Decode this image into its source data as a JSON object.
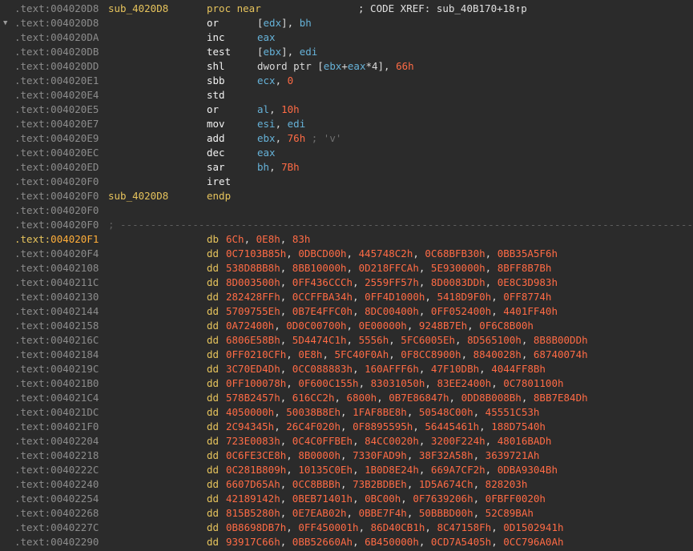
{
  "segment": ".text",
  "code": [
    {
      "addr": "004020D8",
      "label": "sub_4020D8",
      "mnem": "proc near",
      "mnem_kw": true,
      "xref": "; CODE XREF: sub_40B170+18↑p",
      "ops": []
    },
    {
      "addr": "004020D8",
      "arrow": "▼",
      "mnem": "or",
      "ops": [
        {
          "t": "txt",
          "v": "["
        },
        {
          "t": "reg",
          "v": "edx"
        },
        {
          "t": "txt",
          "v": "], "
        },
        {
          "t": "reg",
          "v": "bh"
        }
      ]
    },
    {
      "addr": "004020DA",
      "mnem": "inc",
      "ops": [
        {
          "t": "reg",
          "v": "eax"
        }
      ]
    },
    {
      "addr": "004020DB",
      "mnem": "test",
      "ops": [
        {
          "t": "txt",
          "v": "["
        },
        {
          "t": "reg",
          "v": "ebx"
        },
        {
          "t": "txt",
          "v": "], "
        },
        {
          "t": "reg",
          "v": "edi"
        }
      ]
    },
    {
      "addr": "004020DD",
      "mnem": "shl",
      "ops": [
        {
          "t": "txt",
          "v": "dword ptr ["
        },
        {
          "t": "reg",
          "v": "ebx"
        },
        {
          "t": "txt",
          "v": "+"
        },
        {
          "t": "reg",
          "v": "eax"
        },
        {
          "t": "txt",
          "v": "*4], "
        },
        {
          "t": "num",
          "v": "66h"
        }
      ]
    },
    {
      "addr": "004020E1",
      "mnem": "sbb",
      "ops": [
        {
          "t": "reg",
          "v": "ecx"
        },
        {
          "t": "txt",
          "v": ", "
        },
        {
          "t": "num",
          "v": "0"
        }
      ]
    },
    {
      "addr": "004020E4",
      "mnem": "std",
      "ops": []
    },
    {
      "addr": "004020E5",
      "mnem": "or",
      "ops": [
        {
          "t": "reg",
          "v": "al"
        },
        {
          "t": "txt",
          "v": ", "
        },
        {
          "t": "num",
          "v": "10h"
        }
      ]
    },
    {
      "addr": "004020E7",
      "mnem": "mov",
      "ops": [
        {
          "t": "reg",
          "v": "esi"
        },
        {
          "t": "txt",
          "v": ", "
        },
        {
          "t": "reg",
          "v": "edi"
        }
      ]
    },
    {
      "addr": "004020E9",
      "mnem": "add",
      "ops": [
        {
          "t": "reg",
          "v": "ebx"
        },
        {
          "t": "txt",
          "v": ", "
        },
        {
          "t": "num",
          "v": "76h"
        },
        {
          "t": "cmt",
          "v": " ; 'v'"
        }
      ]
    },
    {
      "addr": "004020EC",
      "mnem": "dec",
      "ops": [
        {
          "t": "reg",
          "v": "eax"
        }
      ]
    },
    {
      "addr": "004020ED",
      "mnem": "sar",
      "ops": [
        {
          "t": "reg",
          "v": "bh"
        },
        {
          "t": "txt",
          "v": ", "
        },
        {
          "t": "num",
          "v": "7Bh"
        }
      ]
    },
    {
      "addr": "004020F0",
      "mnem": "iret",
      "ops": []
    },
    {
      "addr": "004020F0",
      "label": "sub_4020D8",
      "mnem": "endp",
      "mnem_kw": true,
      "ops": []
    },
    {
      "addr": "004020F0",
      "mnem": "",
      "ops": []
    }
  ],
  "separator": {
    "addr": "004020F0",
    "text": "; ---------------------------------------------------------------------------------------------------"
  },
  "data_lines": [
    {
      "addr": "004020F1",
      "hl": true,
      "dir": "db",
      "vals": [
        "6Ch",
        "0E8h",
        "83h"
      ]
    },
    {
      "addr": "004020F4",
      "dir": "dd",
      "vals": [
        "0C7103B85h",
        "0DBCD00h",
        "445748C2h",
        "0C68BFB30h",
        "0BB35A5F6h"
      ]
    },
    {
      "addr": "00402108",
      "dir": "dd",
      "vals": [
        "538D8BB8h",
        "8BB10000h",
        "0D218FFCAh",
        "5E930000h",
        "8BFF8B7Bh"
      ]
    },
    {
      "addr": "0040211C",
      "dir": "dd",
      "vals": [
        "8D003500h",
        "0FF436CCCh",
        "2559FF57h",
        "8D0083DDh",
        "0E8C3D983h"
      ]
    },
    {
      "addr": "00402130",
      "dir": "dd",
      "vals": [
        "282428FFh",
        "0CCFFBA34h",
        "0FF4D1000h",
        "5418D9F0h",
        "0FF8774h"
      ]
    },
    {
      "addr": "00402144",
      "dir": "dd",
      "vals": [
        "5709755Eh",
        "0B7E4FFC0h",
        "8DC00400h",
        "0FF052400h",
        "4401FF40h"
      ]
    },
    {
      "addr": "00402158",
      "dir": "dd",
      "vals": [
        "0A72400h",
        "0D0C00700h",
        "0E00000h",
        "9248B7Eh",
        "0F6C8B00h"
      ]
    },
    {
      "addr": "0040216C",
      "dir": "dd",
      "vals": [
        "6806E58Bh",
        "5D4474C1h",
        "5556h",
        "5FC6005Eh",
        "8D565100h",
        "8B8B00DDh"
      ]
    },
    {
      "addr": "00402184",
      "dir": "dd",
      "vals": [
        "0FF0210CFh",
        "0E8h",
        "5FC40F0Ah",
        "0F8CC8900h",
        "8840028h",
        "68740074h"
      ]
    },
    {
      "addr": "0040219C",
      "dir": "dd",
      "vals": [
        "3C70ED4Dh",
        "0CC088883h",
        "160AFFF6h",
        "47F10DBh",
        "4044FF8Bh"
      ]
    },
    {
      "addr": "004021B0",
      "dir": "dd",
      "vals": [
        "0FF100078h",
        "0F600C155h",
        "83031050h",
        "83EE2400h",
        "0C7801100h"
      ]
    },
    {
      "addr": "004021C4",
      "dir": "dd",
      "vals": [
        "578B2457h",
        "616CC2h",
        "6800h",
        "0B7E86847h",
        "0DD8B008Bh",
        "8BB7E84Dh"
      ]
    },
    {
      "addr": "004021DC",
      "dir": "dd",
      "vals": [
        "4050000h",
        "50038B8Eh",
        "1FAF8BE8h",
        "50548C00h",
        "45551C53h"
      ]
    },
    {
      "addr": "004021F0",
      "dir": "dd",
      "vals": [
        "2C94345h",
        "26C4F020h",
        "0F8895595h",
        "56445461h",
        "188D7540h"
      ]
    },
    {
      "addr": "00402204",
      "dir": "dd",
      "vals": [
        "723E0083h",
        "0C4C0FFBEh",
        "84CC0020h",
        "3200F224h",
        "48016BADh"
      ]
    },
    {
      "addr": "00402218",
      "dir": "dd",
      "vals": [
        "0C6FE3CE8h",
        "8B0000h",
        "7330FAD9h",
        "38F32A58h",
        "3639721Ah"
      ]
    },
    {
      "addr": "0040222C",
      "dir": "dd",
      "vals": [
        "0C281B809h",
        "10135C0Eh",
        "1B0D8E24h",
        "669A7CF2h",
        "0DBA9304Bh"
      ]
    },
    {
      "addr": "00402240",
      "dir": "dd",
      "vals": [
        "6607D65Ah",
        "0CC8BBBh",
        "73B2BDBEh",
        "1D5A674Ch",
        "828203h"
      ]
    },
    {
      "addr": "00402254",
      "dir": "dd",
      "vals": [
        "42189142h",
        "0BEB71401h",
        "0BC00h",
        "0F7639206h",
        "0FBFF0020h"
      ]
    },
    {
      "addr": "00402268",
      "dir": "dd",
      "vals": [
        "815B5280h",
        "0E7EAB02h",
        "0BBE7F4h",
        "50BBBD00h",
        "52C89BAh"
      ]
    },
    {
      "addr": "0040227C",
      "dir": "dd",
      "vals": [
        "0B8698DB7h",
        "0FF450001h",
        "86D40CB1h",
        "8C47158Fh",
        "0D1502941h"
      ]
    },
    {
      "addr": "00402290",
      "dir": "dd",
      "vals": [
        "93917C66h",
        "0BB52660Ah",
        "6B450000h",
        "0CD7A5405h",
        "0CC796A0Ah"
      ]
    }
  ]
}
